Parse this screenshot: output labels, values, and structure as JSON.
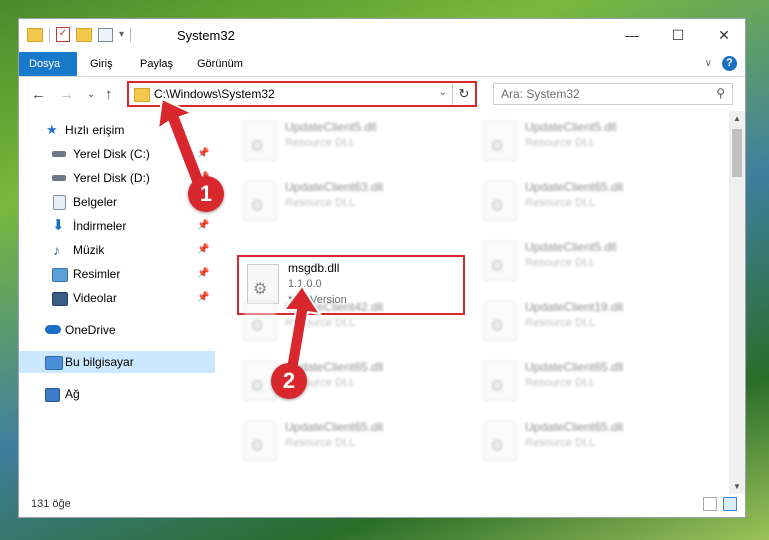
{
  "window": {
    "title": "System32",
    "minimize_icon": "minimize-icon",
    "maximize_icon": "maximize-icon",
    "close_icon": "close-icon"
  },
  "ribbon": {
    "tabs": [
      {
        "label": "Dosya",
        "active": true
      },
      {
        "label": "Giriş"
      },
      {
        "label": "Paylaş"
      },
      {
        "label": "Görünüm"
      }
    ],
    "help_label": "?"
  },
  "nav": {
    "address": "C:\\Windows\\System32",
    "search_placeholder": "Ara: System32"
  },
  "sidebar": {
    "items": [
      {
        "label": "Hızlı erişim",
        "icon": "star-icon",
        "color": "#1a6fc4"
      },
      {
        "label": "Yerel Disk (C:)",
        "icon": "drive-icon",
        "pinned": true
      },
      {
        "label": "Yerel Disk (D:)",
        "icon": "drive-icon",
        "pinned": true
      },
      {
        "label": "Belgeler",
        "icon": "documents-icon",
        "pinned": true
      },
      {
        "label": "İndirmeler",
        "icon": "download-icon",
        "pinned": true
      },
      {
        "label": "Müzik",
        "icon": "music-icon",
        "pinned": true
      },
      {
        "label": "Resimler",
        "icon": "pictures-icon",
        "pinned": true
      },
      {
        "label": "Videolar",
        "icon": "videos-icon",
        "pinned": true
      },
      {
        "label": "OneDrive",
        "icon": "cloud-icon"
      },
      {
        "label": "Bu bilgisayar",
        "icon": "computer-icon",
        "selected": true
      },
      {
        "label": "Ağ",
        "icon": "network-icon"
      }
    ]
  },
  "files": [
    {
      "name": "UpdateClient5.dll",
      "type": "Resource DLL",
      "blurred": true
    },
    {
      "name": "UpdateClient5.dll",
      "type": "Resource DLL",
      "blurred": true
    },
    {
      "name": "UpdateClient63.dll",
      "type": "Resource DLL",
      "blurred": true
    },
    {
      "name": "UpdateClient65.dll",
      "type": "Resource DLL",
      "blurred": true
    },
    {
      "name": "msgdb.dll",
      "version": "1.1.0.0",
      "desc": "*FileVersion",
      "highlighted": true
    },
    {
      "name": "UpdateClient5.dll",
      "type": "Resource DLL",
      "blurred": true
    },
    {
      "name": "UpdateClient42.dll",
      "type": "Resource DLL",
      "blurred": true
    },
    {
      "name": "UpdateClient19.dll",
      "type": "Resource DLL",
      "blurred": true
    },
    {
      "name": "UpdateClient65.dll",
      "type": "Resource DLL",
      "blurred": true
    },
    {
      "name": "UpdateClient65.dll",
      "type": "Resource DLL",
      "blurred": true
    },
    {
      "name": "UpdateClient65.dll",
      "type": "Resource DLL",
      "blurred": true
    },
    {
      "name": "UpdateClient65.dll",
      "type": "Resource DLL",
      "blurred": true
    }
  ],
  "status": {
    "count": "131 öğe"
  },
  "annotations": {
    "step1": "1",
    "step2": "2",
    "color": "#d9272e"
  }
}
